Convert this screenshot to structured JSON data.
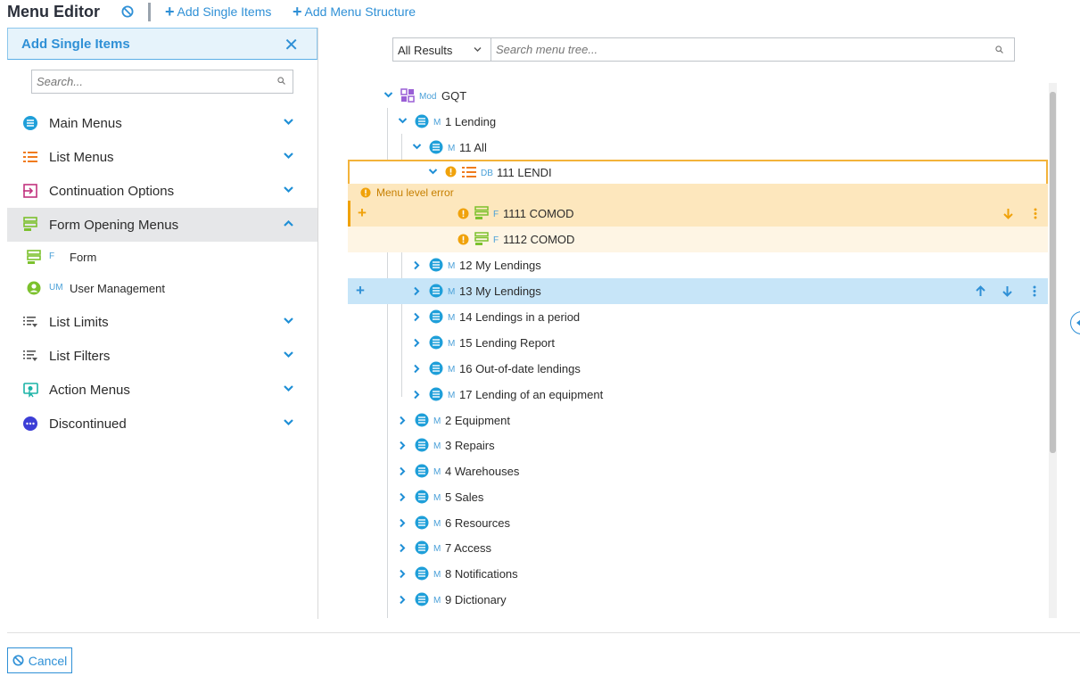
{
  "header": {
    "title": "Menu Editor",
    "add_single_items": "Add Single Items",
    "add_menu_structure": "Add Menu Structure"
  },
  "left_panel": {
    "title": "Add Single Items",
    "search_placeholder": "Search...",
    "categories": [
      {
        "label": "Main Menus",
        "icon": "main-menu-icon",
        "expanded": false
      },
      {
        "label": "List Menus",
        "icon": "list-menu-icon",
        "expanded": false
      },
      {
        "label": "Continuation Options",
        "icon": "continuation-icon",
        "expanded": false
      },
      {
        "label": "Form Opening Menus",
        "icon": "form-menu-icon",
        "expanded": true
      },
      {
        "label": "List Limits",
        "icon": "list-limits-icon",
        "expanded": false
      },
      {
        "label": "List Filters",
        "icon": "list-filters-icon",
        "expanded": false
      },
      {
        "label": "Action Menus",
        "icon": "action-menu-icon",
        "expanded": false
      },
      {
        "label": "Discontinued",
        "icon": "discontinued-icon",
        "expanded": false
      }
    ],
    "sub_items": [
      {
        "tag": "F",
        "label": "Form",
        "icon": "form-icon"
      },
      {
        "tag": "UM",
        "label": "User Management",
        "icon": "user-icon"
      }
    ]
  },
  "tree": {
    "filter_value": "All Results",
    "search_placeholder": "Search menu tree...",
    "error_message": "Menu level error",
    "nodes": [
      {
        "tag": "Mod",
        "label": "GQT",
        "icon": "module-icon"
      },
      {
        "tag": "M",
        "label": "1 Lending",
        "icon": "menu-icon"
      },
      {
        "tag": "M",
        "label": "11 All",
        "icon": "menu-icon"
      },
      {
        "tag": "DB",
        "label": "111 LENDI",
        "icon": "list-menu-icon",
        "warning": true
      },
      {
        "tag": "F",
        "label": "1111 COMOD",
        "icon": "form-menu-icon",
        "warning": true
      },
      {
        "tag": "F",
        "label": "1112 COMOD",
        "icon": "form-menu-icon",
        "warning": true
      },
      {
        "tag": "M",
        "label": "12 My Lendings",
        "icon": "menu-icon"
      },
      {
        "tag": "M",
        "label": "13 My Lendings",
        "icon": "menu-icon",
        "selected": true
      },
      {
        "tag": "M",
        "label": "14 Lendings in a period",
        "icon": "menu-icon"
      },
      {
        "tag": "M",
        "label": "15 Lending Report",
        "icon": "menu-icon"
      },
      {
        "tag": "M",
        "label": "16 Out-of-date lendings",
        "icon": "menu-icon"
      },
      {
        "tag": "M",
        "label": "17 Lending of an equipment",
        "icon": "menu-icon"
      },
      {
        "tag": "M",
        "label": "2 Equipment",
        "icon": "menu-icon"
      },
      {
        "tag": "M",
        "label": "3 Repairs",
        "icon": "menu-icon"
      },
      {
        "tag": "M",
        "label": "4 Warehouses",
        "icon": "menu-icon"
      },
      {
        "tag": "M",
        "label": "5 Sales",
        "icon": "menu-icon"
      },
      {
        "tag": "M",
        "label": "6 Resources",
        "icon": "menu-icon"
      },
      {
        "tag": "M",
        "label": "7 Access",
        "icon": "menu-icon"
      },
      {
        "tag": "M",
        "label": "8 Notifications",
        "icon": "menu-icon"
      },
      {
        "tag": "M",
        "label": "9 Dictionary",
        "icon": "menu-icon"
      }
    ]
  },
  "footer": {
    "cancel_label": "Cancel"
  },
  "colors": {
    "accent": "#2f90d6",
    "warning": "#f0a20b",
    "selected_row": "#c7e5f8",
    "form_icon": "#7cc12d",
    "list_icon": "#f07b1d"
  }
}
